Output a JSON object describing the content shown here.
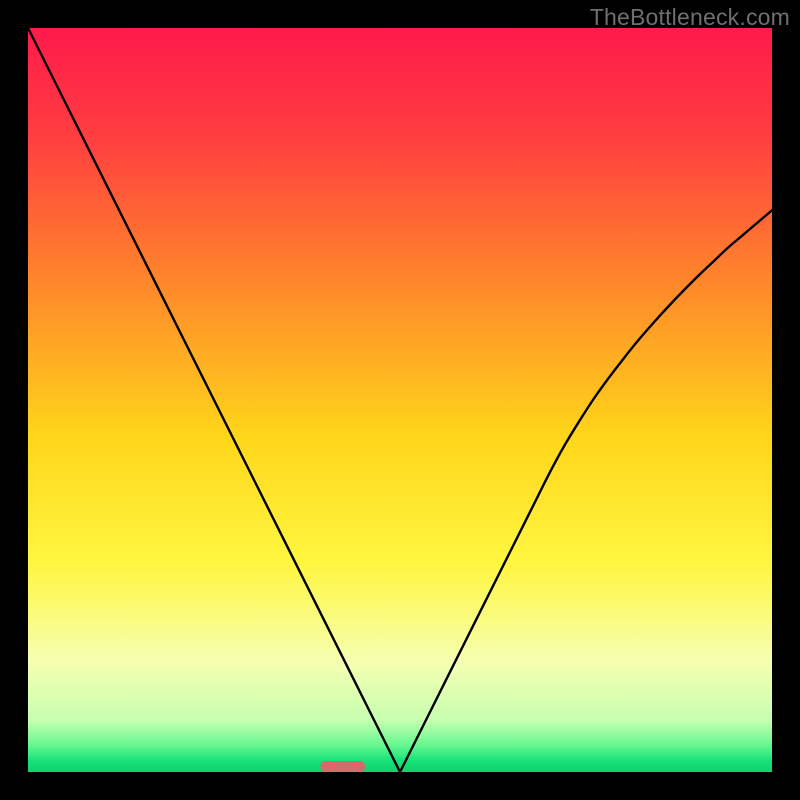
{
  "watermark": "TheBottleneck.com",
  "chart_data": {
    "type": "line",
    "title": "",
    "xlabel": "",
    "ylabel": "",
    "xlim": [
      0,
      1
    ],
    "ylim": [
      0,
      1
    ],
    "x": [
      0.0,
      0.02,
      0.04,
      0.06,
      0.08,
      0.1,
      0.12,
      0.14,
      0.16,
      0.18,
      0.2,
      0.22,
      0.24,
      0.26,
      0.28,
      0.3,
      0.32,
      0.34,
      0.36,
      0.38,
      0.4,
      0.42,
      0.44,
      0.46,
      0.48,
      0.5,
      0.52,
      0.54,
      0.56,
      0.58,
      0.6,
      0.62,
      0.64,
      0.66,
      0.68,
      0.7,
      0.72,
      0.74,
      0.76,
      0.78,
      0.8,
      0.82,
      0.84,
      0.86,
      0.88,
      0.9,
      0.92,
      0.94,
      0.96,
      0.98,
      1.0
    ],
    "y": [
      1.0,
      0.96,
      0.92,
      0.88,
      0.84,
      0.8,
      0.76,
      0.72,
      0.68,
      0.64,
      0.6,
      0.56,
      0.52,
      0.48,
      0.44,
      0.4,
      0.36,
      0.32,
      0.28,
      0.24,
      0.2,
      0.16,
      0.12,
      0.08,
      0.04,
      0.0,
      0.04,
      0.08,
      0.12,
      0.16,
      0.2,
      0.24,
      0.28,
      0.32,
      0.36,
      0.4,
      0.437,
      0.47,
      0.501,
      0.529,
      0.555,
      0.58,
      0.603,
      0.625,
      0.646,
      0.666,
      0.685,
      0.704,
      0.721,
      0.738,
      0.755
    ],
    "marker": {
      "x": 0.423,
      "width": 0.06,
      "color": "#d46a6a"
    },
    "gradient_stops": [
      {
        "offset": 0.0,
        "color": "#ff1a4b"
      },
      {
        "offset": 0.15,
        "color": "#ff3f3f"
      },
      {
        "offset": 0.35,
        "color": "#ff8a2a"
      },
      {
        "offset": 0.55,
        "color": "#ffd61a"
      },
      {
        "offset": 0.72,
        "color": "#fff640"
      },
      {
        "offset": 0.85,
        "color": "#f6ffb0"
      },
      {
        "offset": 0.93,
        "color": "#c8ffb0"
      },
      {
        "offset": 0.965,
        "color": "#63f78f"
      },
      {
        "offset": 0.985,
        "color": "#18e27a"
      },
      {
        "offset": 1.0,
        "color": "#0fd06f"
      }
    ]
  }
}
